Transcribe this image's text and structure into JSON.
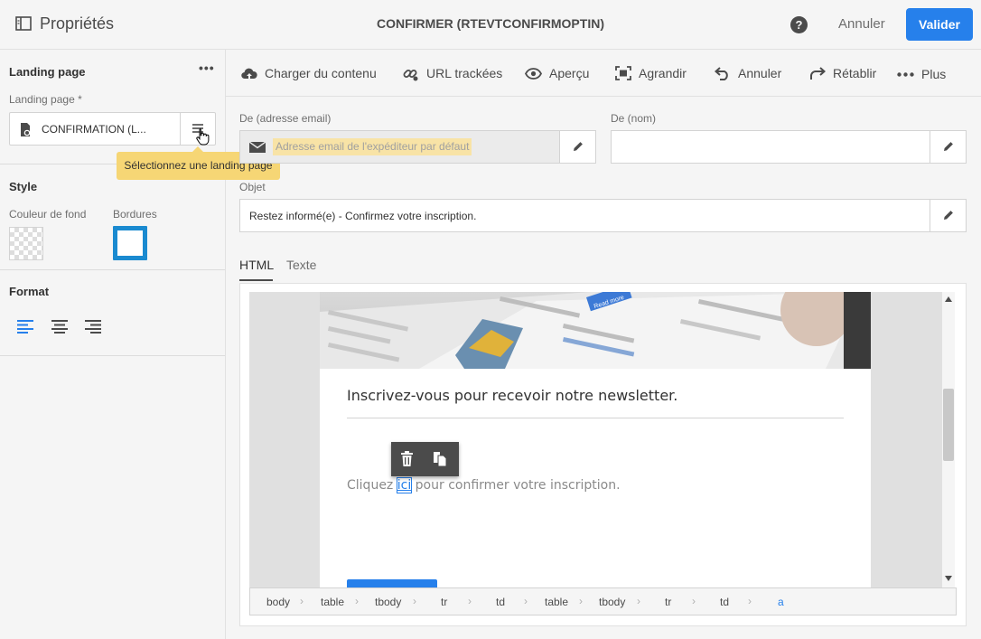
{
  "topbar": {
    "panel_title": "Propriétés",
    "document_title": "CONFIRMER (RTEVTCONFIRMOPTIN)",
    "help_label": "?",
    "cancel_label": "Annuler",
    "validate_label": "Valider",
    "accent_color": "#2680eb"
  },
  "sidebar": {
    "landing_section": {
      "heading": "Landing page",
      "more_label": "•••",
      "field_label": "Landing page *",
      "field_value": "CONFIRMATION (L...",
      "tooltip": "Sélectionnez une landing page"
    },
    "style_section": {
      "heading": "Style",
      "background_color_label": "Couleur de fond",
      "border_label": "Bordures",
      "border_color": "#1a8ad0"
    },
    "format_section": {
      "heading": "Format",
      "alignments": [
        "align-left",
        "align-center",
        "align-right"
      ],
      "active_alignment": "align-left"
    }
  },
  "toolbar": {
    "items": [
      {
        "label": "Charger du contenu",
        "icon": "cloud-upload-icon"
      },
      {
        "label": "URL trackées",
        "icon": "link-icon"
      },
      {
        "label": "Aperçu",
        "icon": "eye-icon"
      },
      {
        "label": "Agrandir",
        "icon": "expand-icon"
      },
      {
        "label": "Annuler",
        "icon": "undo-icon"
      },
      {
        "label": "Rétablir",
        "icon": "redo-icon"
      },
      {
        "label": "Plus",
        "icon": "more-icon"
      }
    ]
  },
  "form": {
    "from_email": {
      "label": "De (adresse email)",
      "placeholder": "Adresse email de l'expéditeur par défaut"
    },
    "from_name": {
      "label": "De (nom)",
      "value": ""
    },
    "subject": {
      "label": "Objet",
      "value": "Restez informé(e) - Confirmez votre inscription."
    }
  },
  "tabs": [
    {
      "label": "HTML",
      "active": true
    },
    {
      "label": "Texte",
      "active": false
    }
  ],
  "email_content": {
    "hero_text": "Read more",
    "heading": "Inscrivez-vous pour recevoir notre newsletter.",
    "body_before": "Cliquez ",
    "link_text": "ici",
    "body_after": " pour confirmer votre inscription."
  },
  "breadcrumb": [
    "body",
    "table",
    "tbody",
    "tr",
    "td",
    "table",
    "tbody",
    "tr",
    "td",
    "a"
  ]
}
